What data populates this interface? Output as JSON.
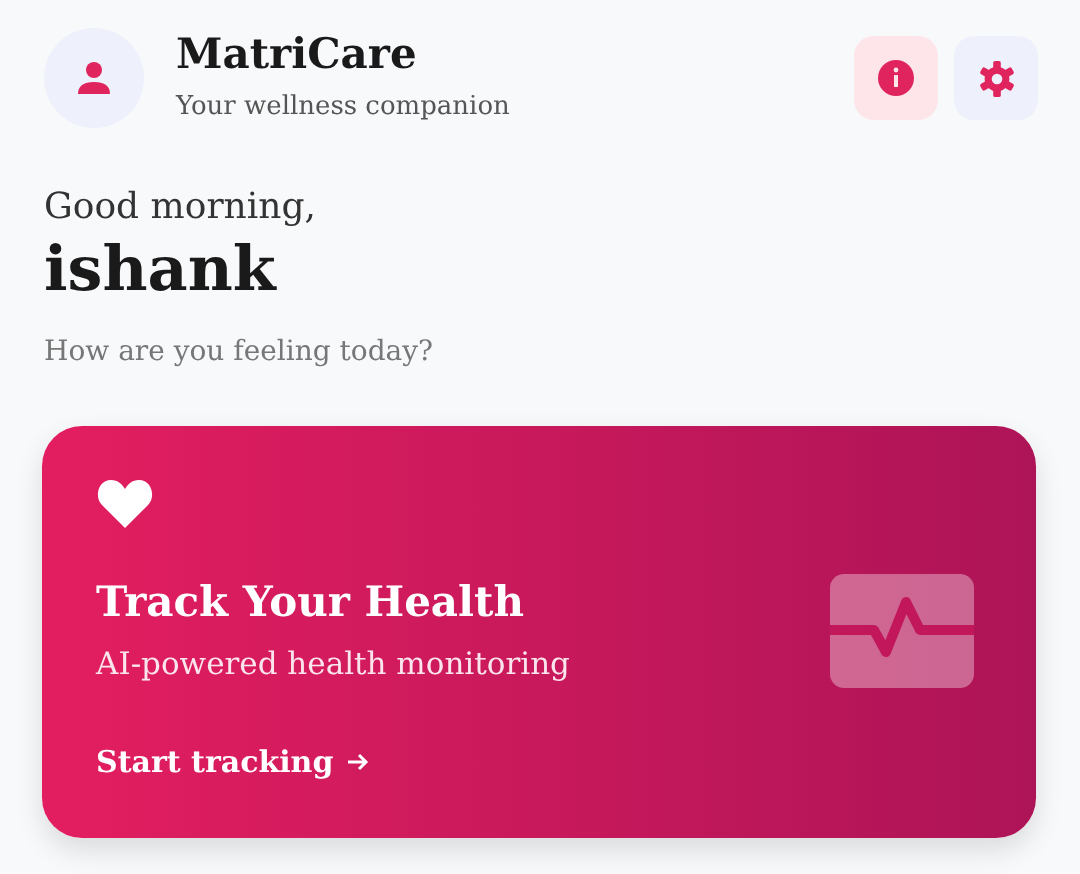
{
  "header": {
    "title": "MatriCare",
    "subtitle": "Your wellness companion"
  },
  "greeting": {
    "salutation": "Good morning,",
    "name": "ishank",
    "question": "How are you feeling today?"
  },
  "card": {
    "title": "Track Your Health",
    "subtitle": "AI-powered health monitoring",
    "link": "Start tracking"
  }
}
